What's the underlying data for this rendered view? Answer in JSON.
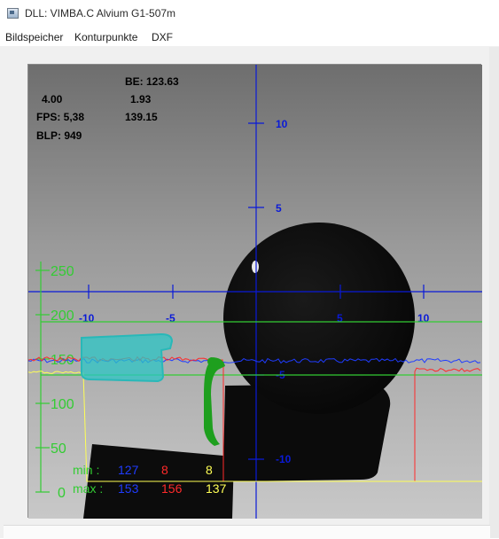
{
  "window": {
    "title": "DLL: VIMBA.C Alvium G1-507m",
    "icon": "camera-app-icon"
  },
  "menu": {
    "items": [
      "Bildspeicher",
      "Konturpunkte",
      "DXF"
    ]
  },
  "overlay": {
    "be_label": "BE: 123.63",
    "value_left": "4.00",
    "value_center": "1.93",
    "fps": "FPS: 5,38",
    "value_center2": "139.15",
    "blp": "BLP: 949"
  },
  "axes": {
    "x_ticks": [
      "-10",
      "-5",
      "5",
      "10"
    ],
    "y_ticks": [
      "10",
      "5",
      "-5",
      "-10"
    ]
  },
  "profile": {
    "y_ticks": [
      "250",
      "200",
      "150",
      "100",
      "50",
      "0"
    ]
  },
  "stats": {
    "min_label": "min :",
    "max_label": "max :",
    "min_values": [
      "127",
      "8",
      "8"
    ],
    "max_values": [
      "153",
      "156",
      "137"
    ]
  },
  "colors": {
    "crosshair": "#0a1ad8",
    "profile_axis": "#33cc33",
    "series_blue": "#1f3cff",
    "series_red": "#ff2a2a",
    "series_yellow": "#ffff55",
    "marker_cyan": "#2bc6c6",
    "marker_green": "#1e9f1e"
  }
}
